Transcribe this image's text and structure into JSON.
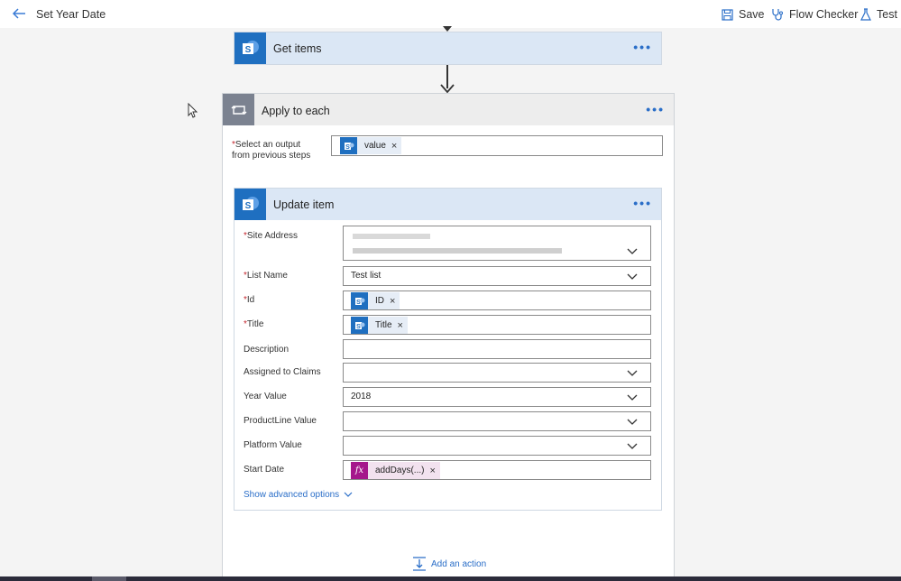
{
  "header": {
    "title": "Set Year Date",
    "save_label": "Save",
    "flow_checker_label": "Flow Checker",
    "test_label": "Test"
  },
  "get_items": {
    "title": "Get items",
    "menu": "•••"
  },
  "apply_to_each": {
    "title": "Apply to each",
    "menu": "•••",
    "output_label_line1": "Select an output",
    "output_label_line2": "from previous steps",
    "required_mark": "*",
    "output_token": "value",
    "add_action_label": "Add an action"
  },
  "update_item": {
    "title": "Update item",
    "menu": "•••",
    "fields": {
      "site_address": {
        "label": "Site Address",
        "required": "*"
      },
      "list_name": {
        "label": "List Name",
        "required": "*",
        "value": "Test list"
      },
      "id": {
        "label": "Id",
        "required": "*",
        "token": "ID"
      },
      "title": {
        "label": "Title",
        "required": "*",
        "token": "Title"
      },
      "description": {
        "label": "Description",
        "value": ""
      },
      "assigned_to_claims": {
        "label": "Assigned to Claims",
        "value": ""
      },
      "year_value": {
        "label": "Year Value",
        "value": "2018"
      },
      "productline_value": {
        "label": "ProductLine Value",
        "value": ""
      },
      "platform_value": {
        "label": "Platform Value",
        "value": ""
      },
      "start_date": {
        "label": "Start Date",
        "token": "addDays(...)",
        "token_icon": "fx"
      }
    },
    "advanced_label": "Show advanced options",
    "token_remove": "×"
  },
  "colors": {
    "accent": "#2a6ec8",
    "sharepoint": "#1f6fc0",
    "expression": "#a5178b",
    "required": "#c4262e"
  },
  "icons": [
    "back-arrow-icon",
    "save-icon",
    "stethoscope-icon",
    "flask-icon",
    "sharepoint-icon",
    "loop-icon",
    "fx-icon",
    "chevron-down-icon",
    "add-action-icon",
    "mouse-cursor-icon"
  ]
}
